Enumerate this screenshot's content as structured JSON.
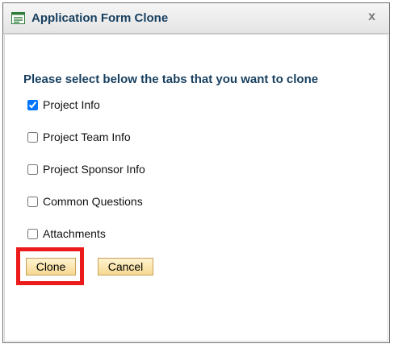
{
  "dialog": {
    "title": "Application Form Clone",
    "close_label": "x",
    "instruction": "Please select below the tabs that you want to clone",
    "options": [
      {
        "label": "Project Info",
        "checked": true
      },
      {
        "label": "Project Team Info",
        "checked": false
      },
      {
        "label": "Project Sponsor Info",
        "checked": false
      },
      {
        "label": "Common Questions",
        "checked": false
      },
      {
        "label": "Attachments",
        "checked": false
      }
    ],
    "buttons": {
      "clone": "Clone",
      "cancel": "Cancel"
    }
  },
  "colors": {
    "title_text": "#173f5f",
    "button_fill": "#f6d992",
    "highlight": "#ec1b1b"
  }
}
